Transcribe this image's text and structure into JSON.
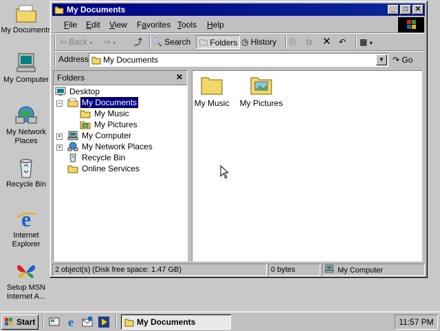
{
  "desktop": {
    "icons": [
      {
        "label": "My Documents",
        "icon": "my-documents-folder-icon"
      },
      {
        "label": "My Computer",
        "icon": "computer-icon"
      },
      {
        "label": "My Network Places",
        "icon": "network-icon"
      },
      {
        "label": "Recycle Bin",
        "icon": "recycle-bin-icon"
      },
      {
        "label": "Internet Explorer",
        "icon": "internet-explorer-icon"
      },
      {
        "label": "Setup MSN Internet A...",
        "icon": "msn-butterfly-icon"
      }
    ]
  },
  "window": {
    "title": "My Documents",
    "controls": {
      "minimize": "_",
      "maximize": "□",
      "close": "✕"
    },
    "menu": [
      "File",
      "Edit",
      "View",
      "Favorites",
      "Tools",
      "Help"
    ],
    "menu_underline": [
      "F",
      "E",
      "V",
      "a",
      "T",
      "H"
    ],
    "toolbar": {
      "back": "Back",
      "search": "Search",
      "folders": "Folders",
      "history": "History"
    },
    "address": {
      "label": "Address",
      "value": "My Documents",
      "go": "Go"
    },
    "folders_pane": {
      "header": "Folders",
      "close": "✕",
      "tree": [
        {
          "label": "Desktop",
          "icon": "desktop-icon",
          "level": 0,
          "expander": ""
        },
        {
          "label": "My Documents",
          "icon": "my-documents-folder-icon",
          "level": 1,
          "expander": "−",
          "selected": true
        },
        {
          "label": "My Music",
          "icon": "folder-icon",
          "level": 2,
          "expander": ""
        },
        {
          "label": "My Pictures",
          "icon": "pictures-folder-icon",
          "level": 2,
          "expander": ""
        },
        {
          "label": "My Computer",
          "icon": "computer-icon",
          "level": 1,
          "expander": "+"
        },
        {
          "label": "My Network Places",
          "icon": "network-icon",
          "level": 1,
          "expander": "+"
        },
        {
          "label": "Recycle Bin",
          "icon": "recycle-bin-icon",
          "level": 1,
          "expander": ""
        },
        {
          "label": "Online Services",
          "icon": "folder-icon",
          "level": 1,
          "expander": ""
        }
      ]
    },
    "content": {
      "items": [
        {
          "label": "My Music",
          "icon": "folder-icon"
        },
        {
          "label": "My Pictures",
          "icon": "pictures-folder-icon"
        }
      ]
    },
    "status": {
      "objects": "2 object(s) (Disk free space: 1.47 GB)",
      "size": "0 bytes",
      "zone": "My Computer"
    }
  },
  "taskbar": {
    "start": "Start",
    "task": "My Documents",
    "clock": "11:57 PM"
  },
  "colors": {
    "titlebar": "#000080",
    "desktop": "#c8c8c8",
    "face": "#c0c0c0",
    "folder": "#f3d768"
  }
}
